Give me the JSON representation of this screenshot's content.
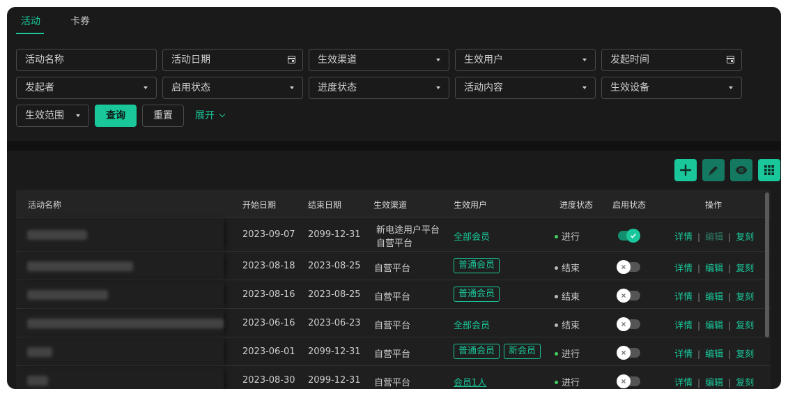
{
  "tabs": [
    {
      "label": "活动",
      "active": true
    },
    {
      "label": "卡券",
      "active": false
    }
  ],
  "filters": {
    "activity_name": "活动名称",
    "activity_date": "活动日期",
    "channel": "生效渠道",
    "users": "生效用户",
    "start_time": "发起时间",
    "initiator": "发起者",
    "enable_status": "启用状态",
    "progress_status": "进度状态",
    "content": "活动内容",
    "device": "生效设备",
    "scope": "生效范围"
  },
  "buttons": {
    "query": "查询",
    "reset": "重置",
    "expand": "展开"
  },
  "toolbar": {
    "add": "plus-icon",
    "edit": "pencil-icon",
    "view": "eye-icon",
    "grid": "grid-icon"
  },
  "colors": {
    "accent": "#19c79a",
    "background": "#1a1a1a"
  },
  "table": {
    "columns": {
      "name": "活动名称",
      "start": "开始日期",
      "end": "结束日期",
      "channel": "生效渠道",
      "users": "生效用户",
      "progress": "进度状态",
      "enabled": "启用状态",
      "actions": "操作"
    },
    "action_labels": {
      "detail": "详情",
      "edit": "编辑",
      "copy": "复刻"
    },
    "rows": [
      {
        "start": "2023-09-07",
        "end": "2099-12-31",
        "channel_1": "新电途用户平台",
        "channel_2": "自营平台",
        "users": "全部会员",
        "progress": "进行"
      },
      {
        "start": "2023-08-18",
        "end": "2023-08-25",
        "channel_1": "自营平台",
        "tag_1": "普通会员",
        "progress": "结束"
      },
      {
        "start": "2023-08-16",
        "end": "2023-08-25",
        "channel_1": "自营平台",
        "tag_1": "普通会员",
        "progress": "结束"
      },
      {
        "start": "2023-06-16",
        "end": "2023-06-23",
        "channel_1": "自营平台",
        "users": "全部会员",
        "progress": "结束"
      },
      {
        "start": "2023-06-01",
        "end": "2099-12-31",
        "channel_1": "自营平台",
        "tag_1": "普通会员",
        "tag_2": "新会员",
        "progress": "进行"
      },
      {
        "start": "2023-08-30",
        "end": "2099-12-31",
        "channel_1": "自营平台",
        "users": "会员1人",
        "progress": "进行"
      }
    ]
  }
}
